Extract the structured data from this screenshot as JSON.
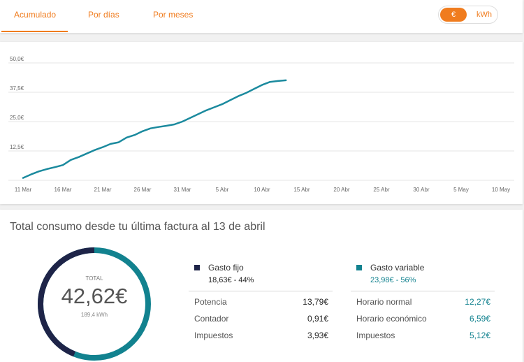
{
  "tabs": [
    {
      "label": "Acumulado"
    },
    {
      "label": "Por días"
    },
    {
      "label": "Por meses"
    }
  ],
  "unit_toggle": {
    "euro": "€",
    "kwh": "kWh",
    "selected": "€"
  },
  "colors": {
    "accent": "#f07c1e",
    "line": "#1b8a9e",
    "fijo": "#1e2448",
    "variable": "#12828f"
  },
  "chart_data": {
    "type": "line",
    "x_tick_labels": [
      "11 Mar",
      "16 Mar",
      "21 Mar",
      "26 Mar",
      "31 Mar",
      "5 Abr",
      "10 Abr",
      "15 Abr",
      "20 Abr",
      "25 Abr",
      "30 Abr",
      "5 May",
      "10 May"
    ],
    "y_tick_labels": [
      "50,0€",
      "37,5€",
      "25,0€",
      "12,5€"
    ],
    "y_ticks": [
      50,
      37.5,
      25,
      12.5
    ],
    "ylim": [
      0,
      50
    ],
    "x_start": "11 Mar",
    "x_end": "10 May",
    "grid": true,
    "series": [
      {
        "x": [
          "11 Mar",
          "12 Mar",
          "13 Mar",
          "14 Mar",
          "15 Mar",
          "16 Mar",
          "17 Mar",
          "18 Mar",
          "19 Mar",
          "20 Mar",
          "21 Mar",
          "22 Mar",
          "23 Mar",
          "24 Mar",
          "25 Mar",
          "26 Mar",
          "27 Mar",
          "28 Mar",
          "29 Mar",
          "30 Mar",
          "31 Mar",
          "1 Abr",
          "2 Abr",
          "3 Abr",
          "4 Abr",
          "5 Abr",
          "6 Abr",
          "7 Abr",
          "8 Abr",
          "9 Abr",
          "10 Abr",
          "11 Abr",
          "12 Abr",
          "13 Abr"
        ],
        "values": [
          1.0,
          2.5,
          3.8,
          4.8,
          5.6,
          6.5,
          8.7,
          9.9,
          11.4,
          12.9,
          14.1,
          15.5,
          16.2,
          18.2,
          19.3,
          20.9,
          22.1,
          22.7,
          23.2,
          23.8,
          25.0,
          26.6,
          28.2,
          29.8,
          31.1,
          32.4,
          34.1,
          35.8,
          37.2,
          38.9,
          40.6,
          41.9,
          42.3,
          42.6
        ]
      }
    ]
  },
  "summary": {
    "title": "Total consumo desde tu última factura al 13 de abril",
    "total_label": "TOTAL",
    "total_amount": "42,62€",
    "total_kwh": "189,4 kWh",
    "fijo_fraction": 0.44,
    "variable_fraction": 0.56,
    "fijo": {
      "title": "Gasto fijo",
      "subtitle": "18,63€ - 44%",
      "rows": [
        {
          "label": "Potencia",
          "value": "13,79€"
        },
        {
          "label": "Contador",
          "value": "0,91€"
        },
        {
          "label": "Impuestos",
          "value": "3,93€"
        }
      ]
    },
    "variable": {
      "title": "Gasto variable",
      "subtitle": "23,98€ - 56%",
      "rows": [
        {
          "label": "Horario normal",
          "value": "12,27€"
        },
        {
          "label": "Horario económico",
          "value": "6,59€"
        },
        {
          "label": "Impuestos",
          "value": "5,12€"
        }
      ]
    }
  }
}
